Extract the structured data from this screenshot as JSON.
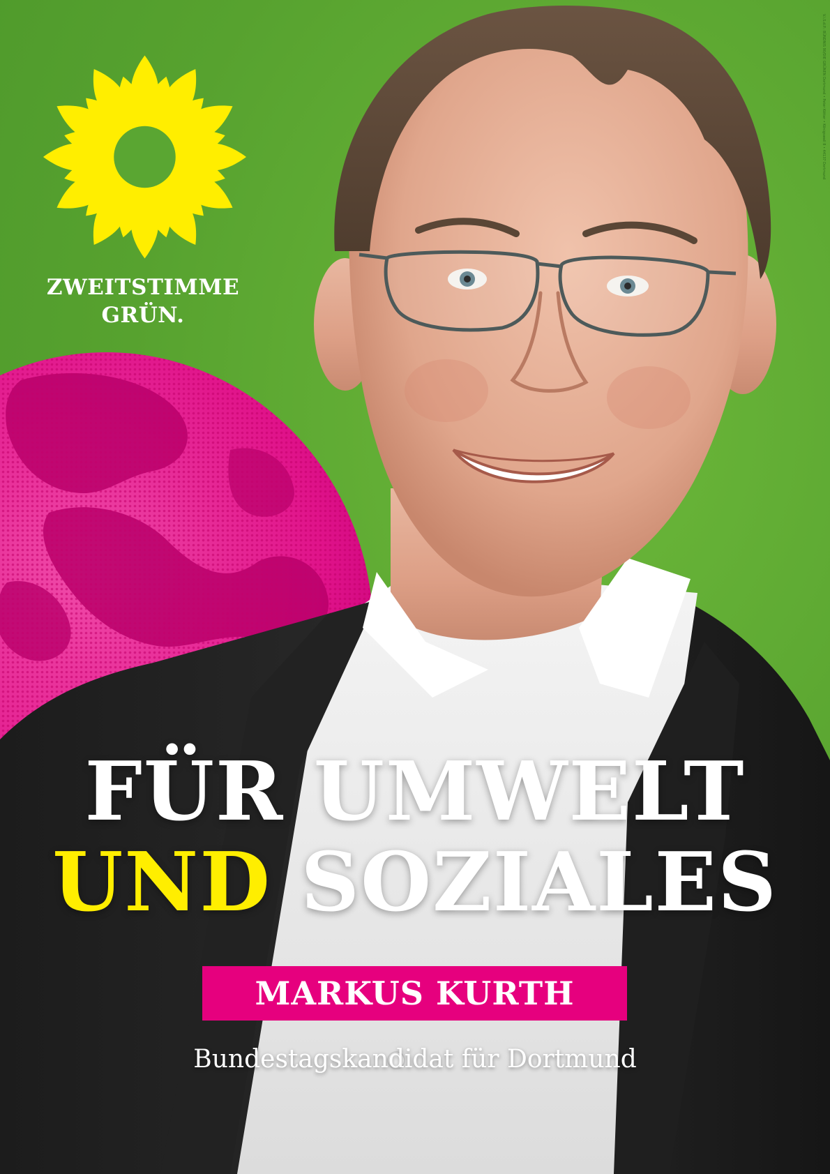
{
  "poster": {
    "slogan_line1": "ZWEITSTIMME",
    "slogan_line2": "GRÜN.",
    "headline_line1": "FÜR UMWELT",
    "headline_line2_accent": "UND",
    "headline_line2_rest": "SOZIALES",
    "candidate_name": "MARKUS KURTH",
    "subtitle": "Bundestagskandidat für Dortmund",
    "legal_notice": "V.i.S.d.P.: BÜNDNIS 90/DIE GRÜNEN Dortmund • Peter Kötter • Königswall 8 • 44137 Dortmund"
  },
  "colors": {
    "background_green": "#5aa632",
    "sunflower_yellow": "#ffee00",
    "magenta": "#e6007e",
    "text_white": "#ffffff"
  },
  "icons": {
    "logo": "sunflower-icon",
    "globe": "globe-illustration"
  }
}
